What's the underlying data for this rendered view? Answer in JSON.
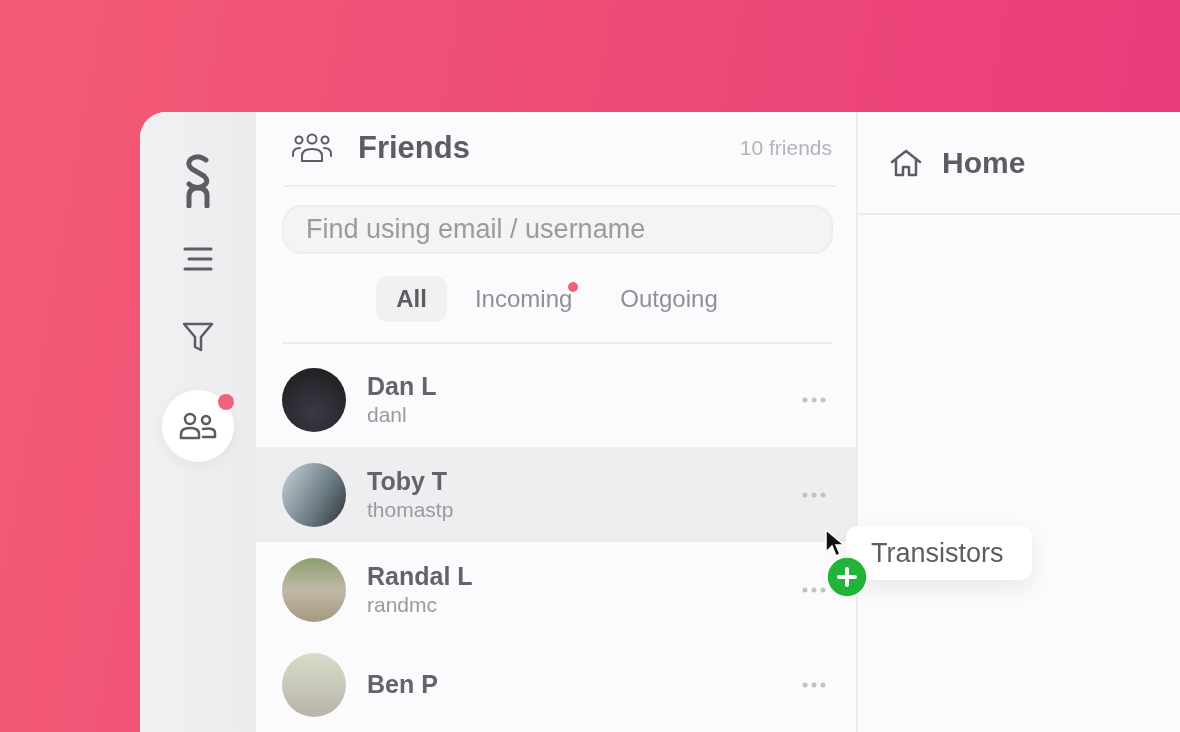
{
  "rail": {
    "items": [
      {
        "kind": "menu",
        "selected": false,
        "has_notification": false
      },
      {
        "kind": "filter",
        "selected": false,
        "has_notification": false
      },
      {
        "kind": "friends",
        "selected": true,
        "has_notification": true
      }
    ]
  },
  "friends_panel": {
    "title": "Friends",
    "count": "10 friends",
    "search": {
      "placeholder": "Find using email / username"
    },
    "tabs": [
      {
        "label": "All",
        "selected": true,
        "has_notification": false
      },
      {
        "label": "Incoming",
        "selected": false,
        "has_notification": true
      },
      {
        "label": "Outgoing",
        "selected": false,
        "has_notification": false
      }
    ],
    "friends": [
      {
        "name": "Dan L",
        "username": "danl",
        "selected": false
      },
      {
        "name": "Toby T",
        "username": "thomastp",
        "selected": true
      },
      {
        "name": "Randal L",
        "username": "randmc",
        "selected": false
      },
      {
        "name": "Ben P",
        "selected": false
      }
    ]
  },
  "home_panel": {
    "title": "Home"
  },
  "drag_chip": {
    "label": "Transistors"
  }
}
